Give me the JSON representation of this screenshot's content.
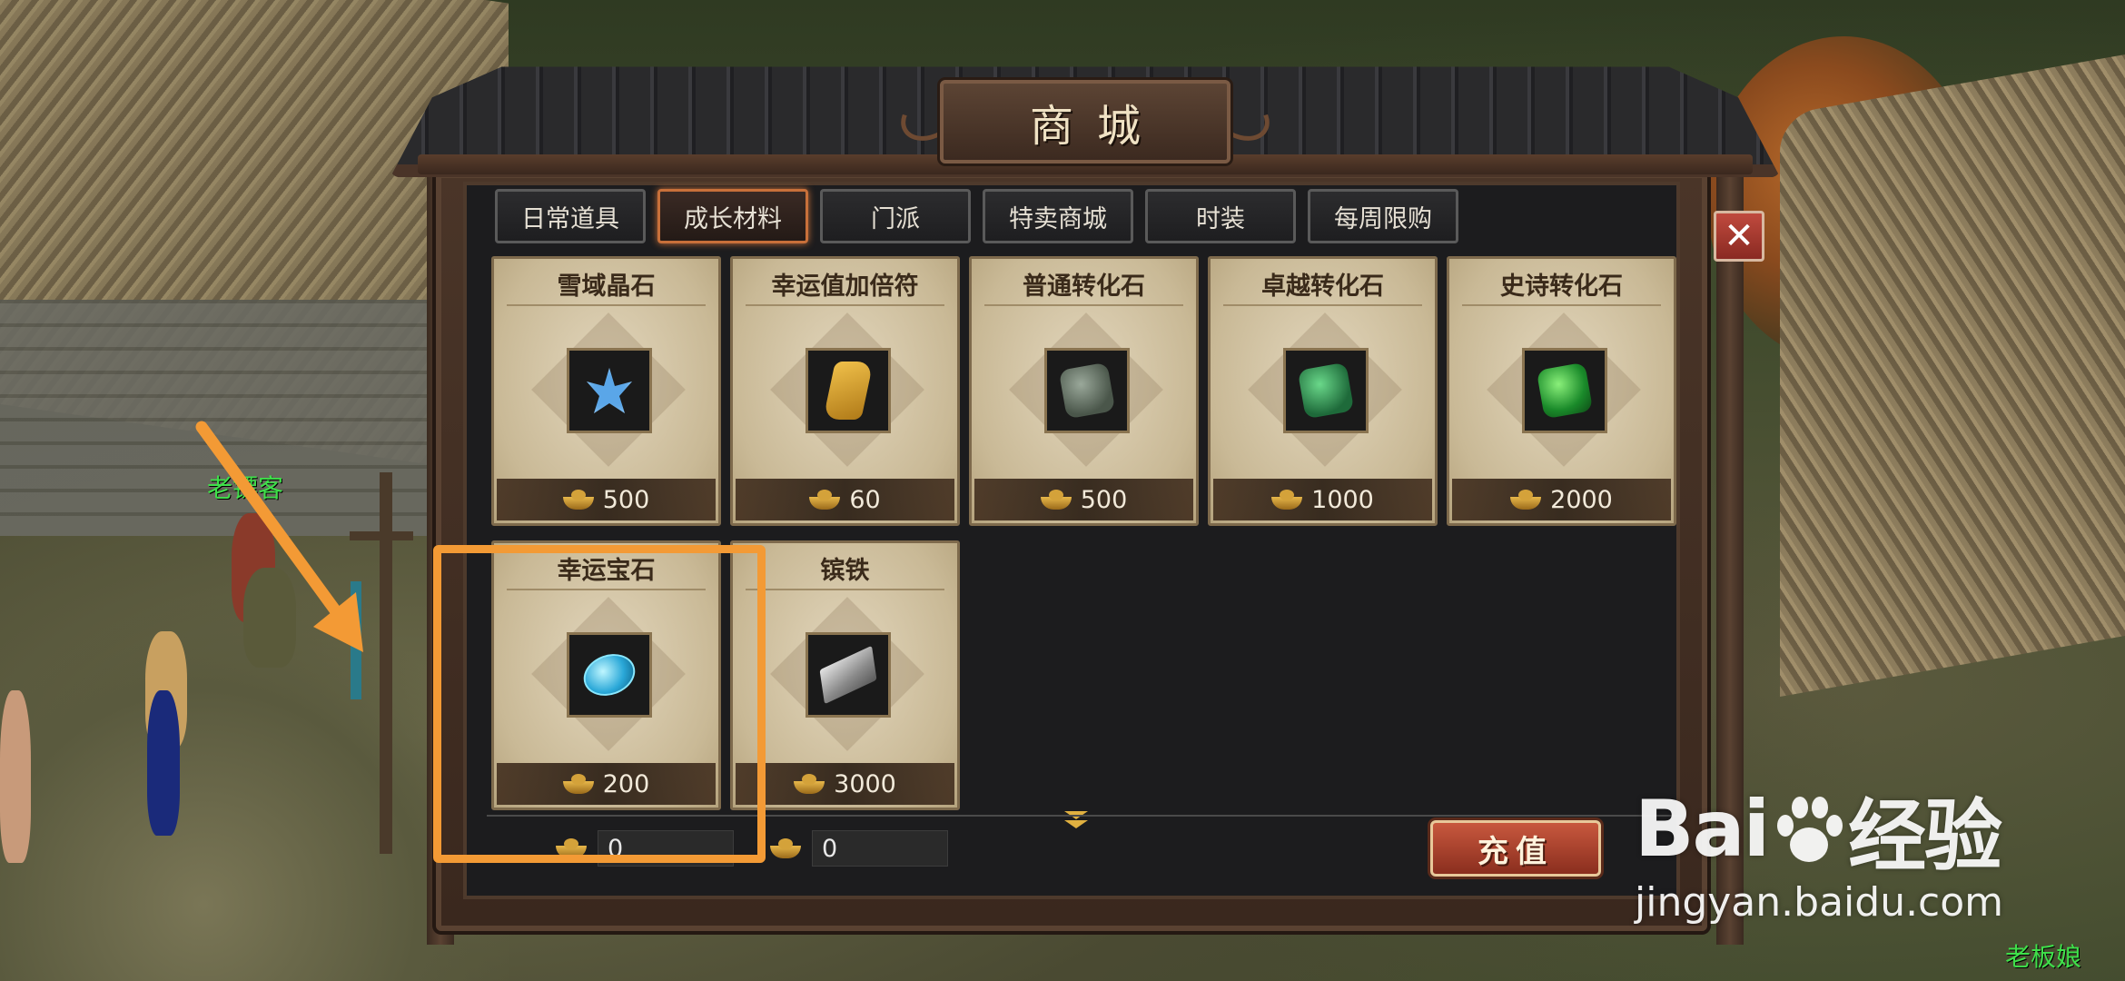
{
  "shop": {
    "title": "商城",
    "tabs": [
      {
        "label": "日常道具",
        "active": false
      },
      {
        "label": "成长材料",
        "active": true
      },
      {
        "label": "门派",
        "active": false
      },
      {
        "label": "特卖商城",
        "active": false
      },
      {
        "label": "时装",
        "active": false
      },
      {
        "label": "每周限购",
        "active": false
      }
    ],
    "items": [
      {
        "name": "雪域晶石",
        "price": "500",
        "icon": "crystal-icon"
      },
      {
        "name": "幸运值加倍符",
        "price": "60",
        "icon": "scroll-icon"
      },
      {
        "name": "普通转化石",
        "price": "500",
        "icon": "stone-icon"
      },
      {
        "name": "卓越转化石",
        "price": "1000",
        "icon": "stone-icon"
      },
      {
        "name": "史诗转化石",
        "price": "2000",
        "icon": "stone-icon"
      },
      {
        "name": "幸运宝石",
        "price": "200",
        "icon": "gem-icon"
      },
      {
        "name": "镔铁",
        "price": "3000",
        "icon": "iron-icon"
      }
    ],
    "currency_gold": "0",
    "currency_bound": "0",
    "recharge_label": "充值",
    "close_label": "✕"
  },
  "scene": {
    "npc_left": "老镖客",
    "npc_bottom_right": "老板娘"
  },
  "watermark": {
    "logo_left": "Bai",
    "logo_right": "经验",
    "url": "jingyan.baidu.com"
  },
  "colors": {
    "accent_tab": "#c8703a",
    "highlight": "#f39a35",
    "npc_name": "#3fe04a",
    "recharge": "#c8583e"
  }
}
